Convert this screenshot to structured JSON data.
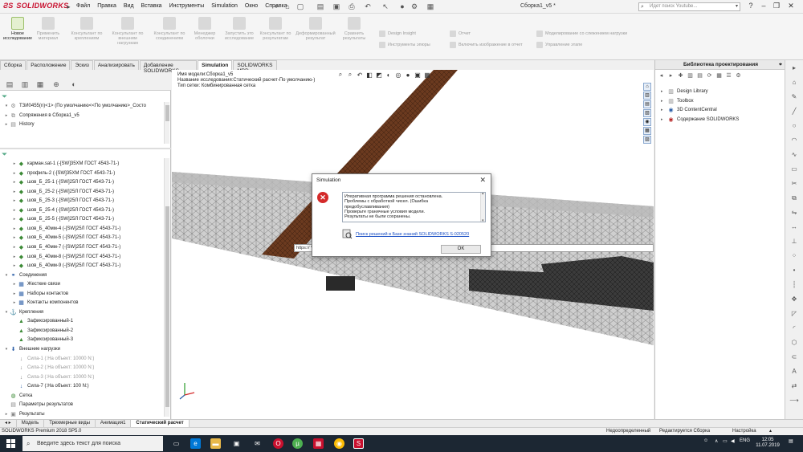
{
  "app": {
    "logo": "SOLIDWORKS",
    "menu": [
      "Файл",
      "Правка",
      "Вид",
      "Вставка",
      "Инструменты",
      "Simulation",
      "Окно",
      "Справка"
    ],
    "document_title": "Сборка1_v5 *",
    "search_placeholder": "Идет поиск Youtube...",
    "window_controls": [
      "?",
      "–",
      "❐",
      "✕"
    ]
  },
  "ribbon": {
    "items": [
      {
        "label": "Новое исследование",
        "active": true
      },
      {
        "label": "Применить материал",
        "active": false
      },
      {
        "label": "Консультант по креплениям",
        "active": false
      },
      {
        "label": "Консультант по внешним нагрузкам",
        "active": false
      },
      {
        "label": "Консультант по соединениям",
        "active": false
      },
      {
        "label": "Менеджер оболочки",
        "active": false
      },
      {
        "label": "Запустить это исследование",
        "active": false
      },
      {
        "label": "Консультант по результатам",
        "active": false
      },
      {
        "label": "Деформированный результат",
        "active": false
      },
      {
        "label": "Сравнить результаты",
        "active": false
      }
    ],
    "small_items": [
      "Design Insight",
      "Отчет",
      "Инструменты эпюры",
      "Включить изображение в отчет",
      "Моделирование со слежением нагрузки",
      "Управление этапе"
    ]
  },
  "command_tabs": [
    "Сборка",
    "Расположение",
    "Эскиз",
    "Анализировать",
    "Добавление SOLIDWORKS",
    "Simulation",
    "SOLIDWORKS MBD"
  ],
  "active_command_tab": "Simulation",
  "feature_tree_top": [
    {
      "label": "ТЗИ0455(n)<1> (По умолчанию<<По умолчанию>_Состо",
      "expand": "▾",
      "icon": "⚙",
      "cls": "ic-grey"
    },
    {
      "label": "Сопряжения в Сборка1_v5",
      "expand": "▸",
      "icon": "⧉",
      "cls": "ic-grey"
    },
    {
      "label": "History",
      "expand": "▸",
      "icon": "▤",
      "cls": "ic-grey"
    }
  ],
  "sim_tree": [
    {
      "label": "карман.sat-1 (-[SW]35ХМ ГОСТ 4543-71-)",
      "indent": 1,
      "icon": "◆",
      "cls": "ic-green",
      "expand": "▸"
    },
    {
      "label": "профиль-2 (-[SW]35ХМ ГОСТ 4543-71-)",
      "indent": 1,
      "icon": "◆",
      "cls": "ic-green",
      "expand": "▸"
    },
    {
      "label": "шов_Б_25-1 (-[SW]25Л ГОСТ 4543-71-)",
      "indent": 1,
      "icon": "◆",
      "cls": "ic-green",
      "expand": "▸"
    },
    {
      "label": "шов_Б_25-2 (-[SW]25Л ГОСТ 4543-71-)",
      "indent": 1,
      "icon": "◆",
      "cls": "ic-green",
      "expand": "▸"
    },
    {
      "label": "шов_Б_25-3 (-[SW]25Л ГОСТ 4543-71-)",
      "indent": 1,
      "icon": "◆",
      "cls": "ic-green",
      "expand": "▸"
    },
    {
      "label": "шов_Б_25-4 (-[SW]25Л ГОСТ 4543-71-)",
      "indent": 1,
      "icon": "◆",
      "cls": "ic-green",
      "expand": "▸"
    },
    {
      "label": "шов_Б_25-5 (-[SW]25Л ГОСТ 4543-71-)",
      "indent": 1,
      "icon": "◆",
      "cls": "ic-green",
      "expand": "▸"
    },
    {
      "label": "шов_Б_40мм-4 (-[SW]25Л ГОСТ 4543-71-)",
      "indent": 1,
      "icon": "◆",
      "cls": "ic-green",
      "expand": "▸"
    },
    {
      "label": "шов_Б_40мм-5 (-[SW]25Л ГОСТ 4543-71-)",
      "indent": 1,
      "icon": "◆",
      "cls": "ic-green",
      "expand": "▸"
    },
    {
      "label": "шов_Б_40мм-7 (-[SW]25Л ГОСТ 4543-71-)",
      "indent": 1,
      "icon": "◆",
      "cls": "ic-green",
      "expand": "▸"
    },
    {
      "label": "шов_Б_40мм-8 (-[SW]25Л ГОСТ 4543-71-)",
      "indent": 1,
      "icon": "◆",
      "cls": "ic-green",
      "expand": "▸"
    },
    {
      "label": "шов_Б_40мм-9 (-[SW]25Л ГОСТ 4543-71-)",
      "indent": 1,
      "icon": "◆",
      "cls": "ic-green",
      "expand": "▸"
    },
    {
      "label": "Соединения",
      "indent": 0,
      "icon": "⚭",
      "cls": "ic-blue",
      "expand": "▾"
    },
    {
      "label": "Жесткие связи",
      "indent": 1,
      "icon": "▦",
      "cls": "ic-blue",
      "expand": "▸"
    },
    {
      "label": "Наборы контактов",
      "indent": 1,
      "icon": "▦",
      "cls": "ic-blue",
      "expand": "▸"
    },
    {
      "label": "Контакты компонентов",
      "indent": 1,
      "icon": "▦",
      "cls": "ic-blue",
      "expand": "▸"
    },
    {
      "label": "Крепления",
      "indent": 0,
      "icon": "⚓",
      "cls": "ic-green",
      "expand": "▾"
    },
    {
      "label": "Зафиксированный-1",
      "indent": 1,
      "icon": "▲",
      "cls": "ic-green",
      "expand": ""
    },
    {
      "label": "Зафиксированный-2",
      "indent": 1,
      "icon": "▲",
      "cls": "ic-green",
      "expand": ""
    },
    {
      "label": "Зафиксированный-3",
      "indent": 1,
      "icon": "▲",
      "cls": "ic-green",
      "expand": ""
    },
    {
      "label": "Внешние нагрузки",
      "indent": 0,
      "icon": "⬇",
      "cls": "ic-blue",
      "expand": "▾"
    },
    {
      "label": "Сила-1 (:На объект: 10000 N:)",
      "indent": 1,
      "icon": "↓",
      "cls": "ic-grey",
      "expand": "",
      "muted": true
    },
    {
      "label": "Сила-2 (:На объект: 10000 N:)",
      "indent": 1,
      "icon": "↓",
      "cls": "ic-grey",
      "expand": "",
      "muted": true
    },
    {
      "label": "Сила-3 (:На объект: 10000 N:)",
      "indent": 1,
      "icon": "↓",
      "cls": "ic-grey",
      "expand": "",
      "muted": true
    },
    {
      "label": "Сила-7 (:На объект: 100 N:)",
      "indent": 1,
      "icon": "↓",
      "cls": "ic-blue",
      "expand": ""
    },
    {
      "label": "Сетка",
      "indent": 0,
      "icon": "◍",
      "cls": "ic-green",
      "expand": ""
    },
    {
      "label": "Параметры результатов",
      "indent": 0,
      "icon": "▤",
      "cls": "ic-grey",
      "expand": ""
    },
    {
      "label": "Результаты",
      "indent": 0,
      "icon": "▣",
      "cls": "ic-grey",
      "expand": "▸"
    }
  ],
  "viewport": {
    "info_lines": [
      "Имя модели:Сборка1_v5",
      "Название исследования:Статический расчет-По умолчанию-)",
      "Тип сетки: Комбинированная сетка"
    ],
    "url_tooltip": "https://                                                           View=SW+Solution+Preview+View+eServiceSWERF=1SWEBU=1SWEAppl"
  },
  "dialog": {
    "title": "Simulation",
    "message_lines": [
      "Итеративная программа решения остановлена.",
      "Проблемы с обработкой чисел. (Ошибка",
      "предобуславливания)",
      "Проверьте граничные условия модели.",
      "Результаты не были сохранены."
    ],
    "link": "Поиск решений в Базе знаний SOLIDWORKS S-020520",
    "ok_label": "OK"
  },
  "design_library": {
    "title": "Библиотека проектирования",
    "items": [
      {
        "label": "Design Library",
        "icon": "▥",
        "cls": "ic-grey"
      },
      {
        "label": "Toolbox",
        "icon": "▥",
        "cls": "ic-grey"
      },
      {
        "label": "3D ContentCentral",
        "icon": "◉",
        "cls": "ic-blue"
      },
      {
        "label": "Содержание SOLIDWORKS",
        "icon": "◉",
        "cls": "ic-red"
      }
    ]
  },
  "bottom_tabs": [
    "Модель",
    "Трехмерные виды",
    "Анимация1",
    "Статический расчет"
  ],
  "active_bottom_tab": "Статический расчет",
  "status": {
    "left": "SOLIDWORKS Premium 2018 SP5.0",
    "items": [
      "Недоопределенный",
      "Редактируется Сборка",
      "Настройка"
    ]
  },
  "taskbar": {
    "search_placeholder": "Введите здесь текст для поиска",
    "lang": "ENG",
    "time": "12:05",
    "date": "11.07.2019"
  },
  "colors": {
    "brand": "#c8102e",
    "error": "#d42a2a",
    "link": "#1a4fc4",
    "taskbar": "#1c2733",
    "beam_brown": "#6b3a1f"
  }
}
